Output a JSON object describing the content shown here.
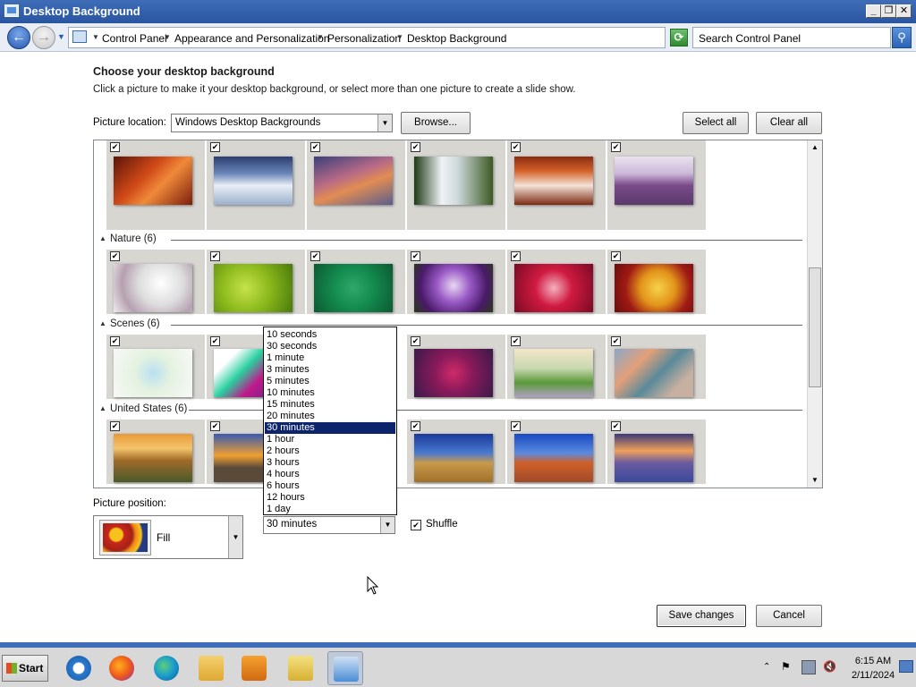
{
  "window": {
    "title": "Desktop Background"
  },
  "address": {
    "crumbs": [
      "Control Panel",
      "Appearance and Personalization",
      "Personalization",
      "Desktop Background"
    ],
    "search_placeholder": "Search Control Panel"
  },
  "page": {
    "heading": "Choose your desktop background",
    "subheading": "Click a picture to make it your desktop background, or select more than one picture to create a slide show.",
    "location_label": "Picture location:",
    "location_value": "Windows Desktop Backgrounds",
    "browse_label": "Browse...",
    "select_all_label": "Select all",
    "clear_all_label": "Clear all"
  },
  "gallery": {
    "groups": [
      {
        "name": "",
        "pictures": [
          "red canyon",
          "icy lake mountains",
          "sunset beach rocks",
          "waterfall forest",
          "rock arch sunset",
          "lavender field"
        ]
      },
      {
        "name": "Nature (6)",
        "pictures": [
          "white feathers",
          "green succulent",
          "green leaves",
          "purple thistle",
          "red flower",
          "autumn leaves"
        ]
      },
      {
        "name": "Scenes (6)",
        "pictures": [
          "colorful painting",
          "fantasy art",
          "",
          "red flowers dark",
          "tulip field",
          "abstract shapes"
        ]
      },
      {
        "name": "United States (6)",
        "pictures": [
          "grassland sunset",
          "coastal cliffs",
          "",
          "hay bale field",
          "delicate arch",
          "lupine lake"
        ]
      }
    ],
    "all_checked": true
  },
  "bottom": {
    "position_label": "Picture position:",
    "position_value": "Fill",
    "interval_value": "30 minutes",
    "interval_options": [
      "10 seconds",
      "30 seconds",
      "1 minute",
      "3 minutes",
      "5 minutes",
      "10 minutes",
      "15 minutes",
      "20 minutes",
      "30 minutes",
      "1 hour",
      "2 hours",
      "3 hours",
      "4 hours",
      "6 hours",
      "12 hours",
      "1 day"
    ],
    "interval_selected_index": 8,
    "shuffle_label": "Shuffle",
    "shuffle_checked": true,
    "save_label": "Save changes",
    "cancel_label": "Cancel"
  },
  "taskbar": {
    "start_label": "Start",
    "apps": [
      "internet-explorer",
      "firefox",
      "edge",
      "file-explorer",
      "media-player",
      "folder",
      "control-panel"
    ],
    "time": "6:15 AM",
    "date": "2/11/2024"
  },
  "colors": {
    "titlebar": "#3f6db8",
    "selection": "#0c246b"
  }
}
